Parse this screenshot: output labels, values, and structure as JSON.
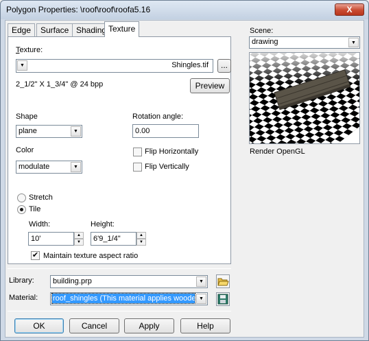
{
  "window": {
    "title": "Polygon Properties: \\roof\\roof\\roofa5.16",
    "close_label": "X"
  },
  "tabs": [
    {
      "label": "Edge"
    },
    {
      "label": "Surface"
    },
    {
      "label": "Shading"
    },
    {
      "label": "Texture",
      "active": true
    }
  ],
  "texture": {
    "label": "Texture:",
    "file": "Shingles.tif",
    "browse_label": "...",
    "info": "2_1/2\" X 1_3/4\" @ 24  bpp",
    "preview_label": "Preview"
  },
  "shape": {
    "label": "Shape",
    "value": "plane"
  },
  "color": {
    "label": "Color",
    "value": "modulate"
  },
  "rotation": {
    "label": "Rotation angle:",
    "value": "0.00"
  },
  "flip_h": {
    "label": "Flip Horizontally",
    "checked": false
  },
  "flip_v": {
    "label": "Flip Vertically",
    "checked": false
  },
  "mapping": {
    "stretch_label": "Stretch",
    "tile_label": "Tile",
    "selected": "Tile"
  },
  "width": {
    "label": "Width:",
    "value": "10'"
  },
  "height": {
    "label": "Height:",
    "value": "6'9_1/4\""
  },
  "aspect": {
    "label": "Maintain texture aspect ratio",
    "checked": true
  },
  "library": {
    "label": "Library:",
    "value": "building.prp"
  },
  "material": {
    "label": "Material:",
    "value": "roof_shingles (This material applies wooden"
  },
  "scene": {
    "label": "Scene:",
    "value": "drawing",
    "render_label": "Render OpenGL"
  },
  "buttons": {
    "ok": "OK",
    "cancel": "Cancel",
    "apply": "Apply",
    "help": "Help"
  },
  "colors": {
    "selection": "#3399ff",
    "checker_dark": "#000000",
    "checker_light": "#ffffff",
    "plank": "#5a5448"
  }
}
